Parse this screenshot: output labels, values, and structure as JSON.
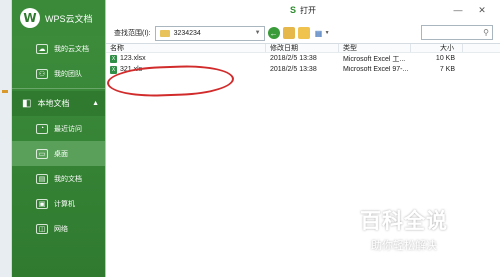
{
  "app": {
    "brand": "WPS云文档"
  },
  "sidebar": {
    "items_top": [
      {
        "label": "我的云文档",
        "icon": "cloud-doc-icon"
      },
      {
        "label": "我的团队",
        "icon": "team-icon"
      }
    ],
    "section": {
      "label": "本地文档",
      "icon": "local-doc-icon"
    },
    "items_local": [
      {
        "label": "最近访问",
        "icon": "recent-icon"
      },
      {
        "label": "桌面",
        "icon": "desktop-icon"
      },
      {
        "label": "我的文档",
        "icon": "my-docs-icon"
      },
      {
        "label": "计算机",
        "icon": "computer-icon"
      },
      {
        "label": "网络",
        "icon": "network-icon"
      }
    ]
  },
  "dialog": {
    "title": "打开",
    "toolbar": {
      "lookin_label": "查找范围(I):",
      "path_value": "3234234"
    },
    "columns": {
      "name": "名称",
      "date": "修改日期",
      "type": "类型",
      "size": "大小"
    },
    "files": [
      {
        "name": "123.xlsx",
        "date": "2018/2/5 13:38",
        "type": "Microsoft Excel 工...",
        "size": "10 KB"
      },
      {
        "name": "321.xls",
        "date": "2018/2/5 13:38",
        "type": "Microsoft Excel 97-...",
        "size": "7 KB"
      }
    ]
  },
  "watermark": {
    "line1": "百科全说",
    "line2": "助你轻松解决"
  },
  "colors": {
    "sidebar": "#2f7a2f",
    "annotation": "#d22b2b"
  }
}
